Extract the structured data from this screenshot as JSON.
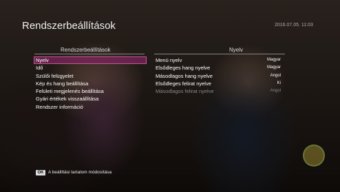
{
  "header": {
    "title": "Rendszerbeállítások",
    "datetime": "2016.07.05. 11:03"
  },
  "menu": {
    "header": "Rendszerbeállítások",
    "selected_index": 0,
    "items": [
      {
        "label": "Nyelv"
      },
      {
        "label": "Idő"
      },
      {
        "label": "Szülői felügyelet"
      },
      {
        "label": "Kép és hang beállítása"
      },
      {
        "label": "Felületi megjelenés beállítása"
      },
      {
        "label": "Gyári értékek visszaállítása"
      },
      {
        "label": "Rendszer információ"
      }
    ]
  },
  "submenu": {
    "header": "Nyelv",
    "items": [
      {
        "label": "Menü nyelv",
        "value": "Magyar",
        "disabled": false
      },
      {
        "label": "Elsődleges hang nyelve",
        "value": "Magyar",
        "disabled": false
      },
      {
        "label": "Másodlagos hang nyelve",
        "value": "Angol",
        "disabled": false
      },
      {
        "label": "Elsődleges felirat nyelve",
        "value": "Ki",
        "disabled": false
      },
      {
        "label": "Másodlagos felirat nyelve",
        "value": "Angol",
        "disabled": true
      }
    ]
  },
  "footer": {
    "key_label": "OK",
    "hint": "A beállítási tartalom módosítása"
  },
  "colors": {
    "highlight": "#d24ea0",
    "disabled_text": "#888888"
  }
}
